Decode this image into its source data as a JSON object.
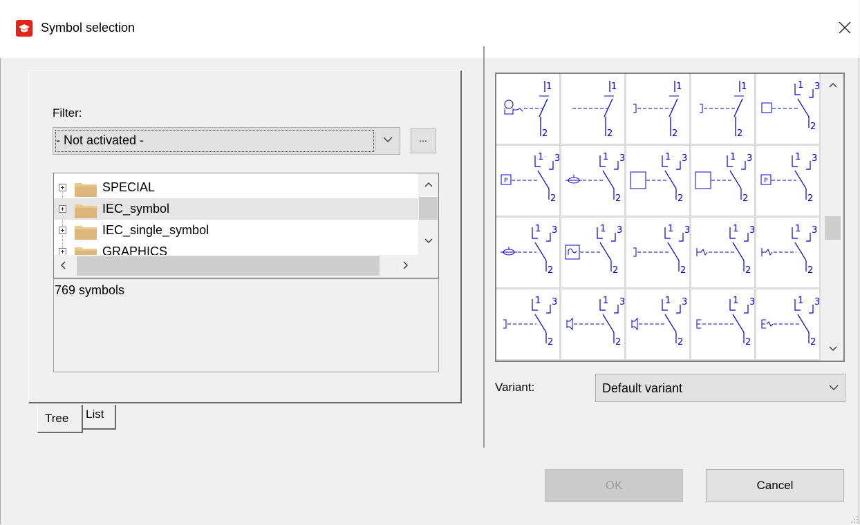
{
  "window": {
    "title": "Symbol selection"
  },
  "filter": {
    "label": "Filter:",
    "value": "- Not activated -",
    "more_button": "..."
  },
  "tree": {
    "items": [
      {
        "label": "SPECIAL",
        "selected": false
      },
      {
        "label": "IEC_symbol",
        "selected": true
      },
      {
        "label": "IEC_single_symbol",
        "selected": false
      },
      {
        "label": "GRAPHICS",
        "selected": false
      }
    ]
  },
  "symbol_count": "769 symbols",
  "tabs": [
    {
      "label": "Tree",
      "active": true
    },
    {
      "label": "List",
      "active": false
    }
  ],
  "symbols": {
    "color": "#0000cc",
    "rows": [
      [
        {
          "kind": "single",
          "actuator": "key",
          "labels": [
            "1",
            "2"
          ]
        },
        {
          "kind": "single",
          "actuator": "dashed",
          "labels": [
            "1",
            "2"
          ]
        },
        {
          "kind": "single",
          "actuator": "bracket",
          "labels": [
            "1",
            "2"
          ]
        },
        {
          "kind": "single",
          "actuator": "bracket-short",
          "labels": [
            "1",
            "2"
          ]
        },
        {
          "kind": "changeover",
          "actuator": "square",
          "labels": [
            "1",
            "2",
            "3"
          ]
        }
      ],
      [
        {
          "kind": "changeover",
          "actuator": "p-box",
          "labels": [
            "1",
            "2",
            "3"
          ]
        },
        {
          "kind": "changeover",
          "actuator": "roller",
          "labels": [
            "1",
            "2",
            "3"
          ]
        },
        {
          "kind": "changeover-wide",
          "actuator": "big-square",
          "labels": [
            "1",
            "2",
            "3"
          ]
        },
        {
          "kind": "changeover-wide",
          "actuator": "big-square",
          "labels": [
            "1",
            "2",
            "3"
          ]
        },
        {
          "kind": "changeover-wide",
          "actuator": "p-box",
          "labels": [
            "1",
            "2",
            "3"
          ]
        }
      ],
      [
        {
          "kind": "changeover-wide",
          "actuator": "roller",
          "labels": [
            "1",
            "2",
            "3"
          ]
        },
        {
          "kind": "changeover-wide",
          "actuator": "thermal",
          "labels": [
            "1",
            "2",
            "3"
          ]
        },
        {
          "kind": "changeover",
          "actuator": "bracket",
          "labels": [
            "1",
            "2",
            "3"
          ]
        },
        {
          "kind": "changeover",
          "actuator": "bracket-wave",
          "labels": [
            "1",
            "2",
            "3"
          ]
        },
        {
          "kind": "changeover-wide",
          "actuator": "bracket-wave",
          "labels": [
            "1",
            "2",
            "3"
          ]
        }
      ],
      [
        {
          "kind": "changeover-wide",
          "actuator": "bracket",
          "labels": [
            "1",
            "2",
            "3"
          ]
        },
        {
          "kind": "changeover",
          "actuator": "horn",
          "labels": [
            "1",
            "2",
            "3"
          ]
        },
        {
          "kind": "changeover-wide",
          "actuator": "horn",
          "labels": [
            "1",
            "2",
            "3"
          ]
        },
        {
          "kind": "changeover",
          "actuator": "e-mark",
          "labels": [
            "1",
            "2",
            "3"
          ]
        },
        {
          "kind": "changeover",
          "actuator": "e-wave",
          "labels": [
            "1",
            "2",
            "3"
          ]
        }
      ]
    ]
  },
  "variant": {
    "label": "Variant:",
    "value": "Default variant"
  },
  "buttons": {
    "ok": "OK",
    "cancel": "Cancel",
    "ok_enabled": false
  }
}
